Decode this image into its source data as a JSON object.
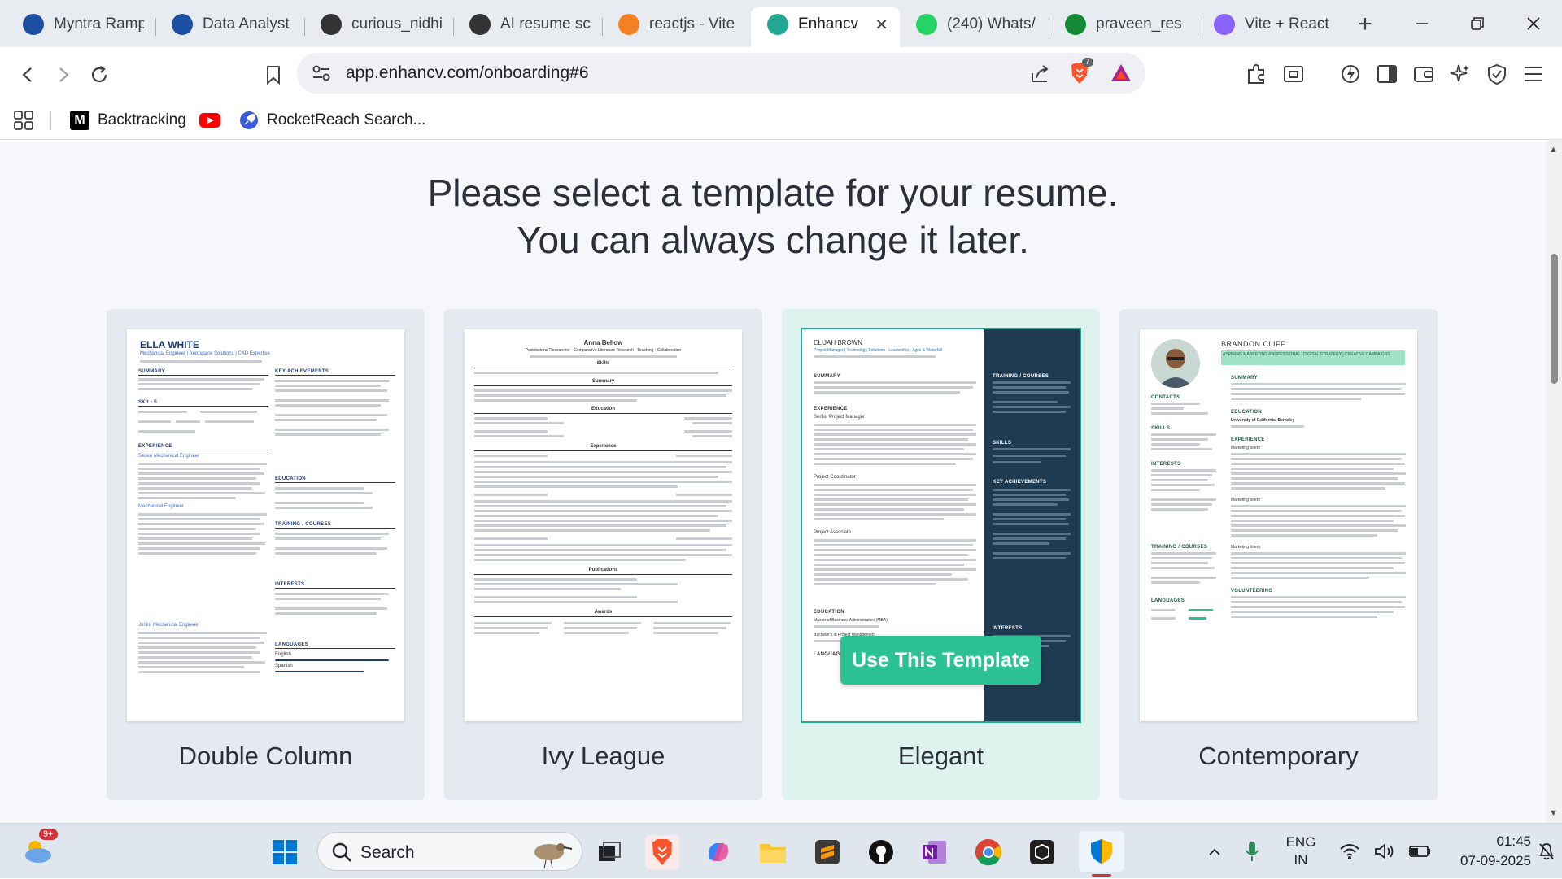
{
  "browser": {
    "tabs": [
      {
        "title": "Myntra Ramp",
        "icon": "unstop-icon",
        "color": "#1c4fa1"
      },
      {
        "title": "Data Analyst",
        "icon": "unstop-icon",
        "color": "#1c4fa1"
      },
      {
        "title": "curious_nidhi",
        "icon": "leetcode-icon",
        "color": "#333333"
      },
      {
        "title": "AI resume sc",
        "icon": "openai-icon",
        "color": "#333333"
      },
      {
        "title": "reactjs - Vite",
        "icon": "stackoverflow-icon",
        "color": "#f48024"
      },
      {
        "title": "Enhancv",
        "icon": "enhancv-icon",
        "color": "#22a892",
        "active": true
      },
      {
        "title": "(240) Whats/",
        "icon": "whatsapp-icon",
        "color": "#25d366"
      },
      {
        "title": "praveen_res",
        "icon": "overleaf-icon",
        "color": "#138a36"
      },
      {
        "title": "Vite + React",
        "icon": "vite-icon",
        "color": "#8a63ff"
      }
    ],
    "url": "app.enhancv.com/onboarding#6",
    "brave_badge": "7",
    "bookmarks": [
      {
        "label": "Backtracking",
        "icon": "medium-icon"
      },
      {
        "label": "",
        "icon": "youtube-icon"
      },
      {
        "label": "RocketReach Search...",
        "icon": "rocketreach-icon"
      }
    ]
  },
  "page": {
    "heading_line1": "Please select a template for your resume.",
    "heading_line2": "You can always change it later.",
    "use_template_label": "Use This Template",
    "templates": [
      {
        "label": "Double Column",
        "preview": {
          "name": "ELLA WHITE",
          "subtitle": "Mechanical Engineer | Aerospace Solutions | CAD Expertise",
          "sections_left": [
            "SUMMARY",
            "SKILLS",
            "EXPERIENCE"
          ],
          "sections_right": [
            "KEY ACHIEVEMENTS",
            "EDUCATION",
            "TRAINING / COURSES",
            "INTERESTS",
            "LANGUAGES"
          ],
          "jobs": [
            "Senior Mechanical Engineer",
            "Mechanical Engineer",
            "Junior Mechanical Engineer"
          ],
          "languages": [
            "English",
            "Spanish"
          ]
        }
      },
      {
        "label": "Ivy League",
        "preview": {
          "name": "Anna Bellow",
          "subtitle": "Postdoctoral Researcher · Comparative Literature Research · Teaching · Collaboration",
          "sections": [
            "Skills",
            "Summary",
            "Education",
            "Experience",
            "Publications",
            "Awards"
          ]
        }
      },
      {
        "label": "Elegant",
        "selected": true,
        "preview": {
          "name": "ELIJAH BROWN",
          "subtitle": "Project Manager | Technology Solutions · Leadership · Agile & Waterfall",
          "sections": [
            "SUMMARY",
            "EXPERIENCE",
            "EDUCATION",
            "LANGUAGES"
          ],
          "side_sections": [
            "TRAINING / COURSES",
            "SKILLS",
            "KEY ACHIEVEMENTS",
            "INTERESTS"
          ],
          "jobs": [
            "Senior Project Manager",
            "Project Coordinator",
            "Project Associate"
          ],
          "education": [
            "Master of Business Administration (MBA)",
            "Bachelor's in Project Management"
          ]
        }
      },
      {
        "label": "Contemporary",
        "preview": {
          "name": "BRANDON CLIFF",
          "subtitle": "ASPIRING MARKETING PROFESSIONAL | DIGITAL STRATEGY | CREATIVE CAMPAIGNS",
          "sections_left": [
            "CONTACTS",
            "SKILLS",
            "INTERESTS",
            "TRAINING / COURSES",
            "LANGUAGES"
          ],
          "sections_right": [
            "SUMMARY",
            "EDUCATION",
            "EXPERIENCE",
            "VOLUNTEERING"
          ],
          "education": "University of California, Berkeley",
          "jobs": [
            "Marketing Intern",
            "Marketing Intern",
            "Marketing Intern"
          ]
        }
      }
    ]
  },
  "taskbar": {
    "weather_badge": "9+",
    "search_label": "Search",
    "lang_top": "ENG",
    "lang_bottom": "IN",
    "time": "01:45",
    "date": "07-09-2025"
  }
}
